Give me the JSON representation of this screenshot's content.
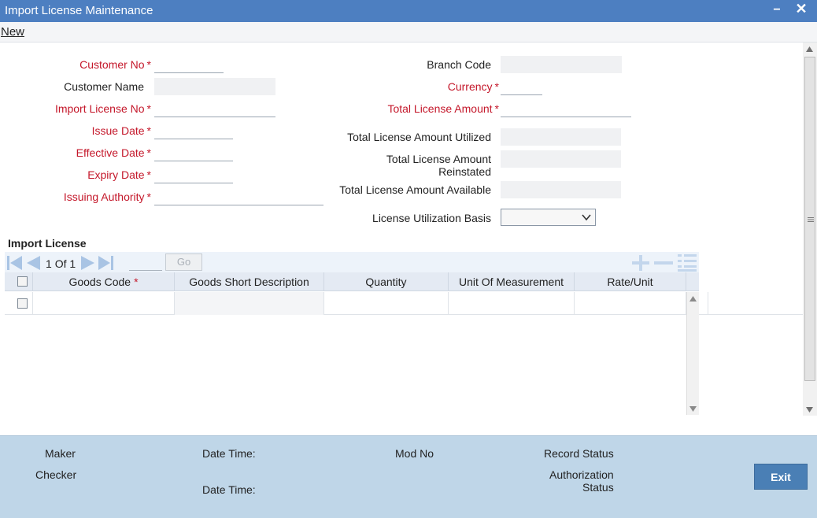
{
  "window": {
    "title": "Import License Maintenance",
    "minimize_glyph": "−",
    "close_glyph": "✕"
  },
  "toolbar": {
    "new_label": "New"
  },
  "form": {
    "customer_no": {
      "label": "Customer No",
      "value": ""
    },
    "customer_name": {
      "label": "Customer Name",
      "value": ""
    },
    "import_license_no": {
      "label": "Import License No",
      "value": ""
    },
    "issue_date": {
      "label": "Issue Date",
      "value": ""
    },
    "effective_date": {
      "label": "Effective Date",
      "value": ""
    },
    "expiry_date": {
      "label": "Expiry Date",
      "value": ""
    },
    "issuing_authority": {
      "label": "Issuing Authority",
      "value": ""
    },
    "branch_code": {
      "label": "Branch Code",
      "value": ""
    },
    "currency": {
      "label": "Currency",
      "value": ""
    },
    "total_license_amount": {
      "label": "Total License Amount",
      "value": ""
    },
    "total_license_amount_utilized": {
      "label": "Total License Amount Utilized",
      "value": ""
    },
    "total_license_amount_reinstated": {
      "label_line1": "Total License Amount",
      "label_line2": "Reinstated",
      "value": ""
    },
    "total_license_amount_available": {
      "label": "Total License Amount Available",
      "value": ""
    },
    "license_utilization_basis": {
      "label": "License Utilization Basis",
      "value": ""
    },
    "required_mark": "*"
  },
  "import_license": {
    "title": "Import License",
    "pager": {
      "current": "1",
      "of_label": "Of",
      "total": "1",
      "go_label": "Go"
    },
    "columns": [
      "Goods Code",
      "Goods Short Description",
      "Quantity",
      "Unit Of Measurement",
      "Rate/Unit"
    ],
    "required_mark": "*"
  },
  "footer": {
    "maker_label": "Maker",
    "checker_label": "Checker",
    "date_time_label_1": "Date Time:",
    "date_time_label_2": "Date Time:",
    "mod_no_label": "Mod No",
    "record_status_label": "Record Status",
    "authorization_status_line1": "Authorization",
    "authorization_status_line2": "Status",
    "exit_label": "Exit"
  },
  "colors": {
    "titlebar": "#4d7fc1",
    "required": "#c4172a",
    "footer": "#bfd6e8",
    "exit_button": "#4a7fb5"
  },
  "icons": [
    "first-page-icon",
    "prev-page-icon",
    "next-page-icon",
    "last-page-icon",
    "add-row-icon",
    "delete-row-icon",
    "single-view-icon",
    "dropdown-arrow-icon",
    "checkbox-icon"
  ]
}
